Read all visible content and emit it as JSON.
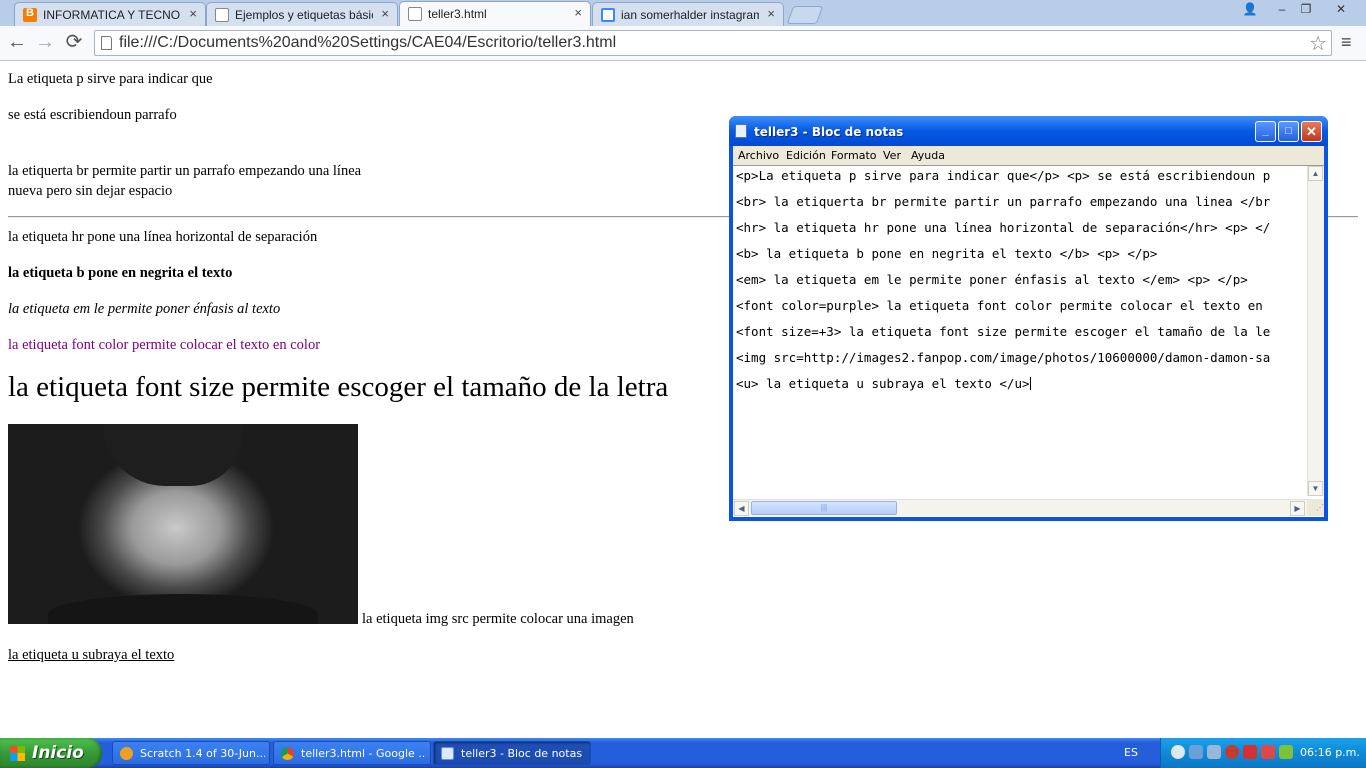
{
  "browser": {
    "tabs": [
      {
        "label": "INFORMATICA Y TECNOLOGIA",
        "close": "×",
        "favicon": "blogger-icon"
      },
      {
        "label": "Ejemplos y etiquetas básicas",
        "close": "×",
        "favicon": "page-icon"
      },
      {
        "label": "teller3.html",
        "close": "×",
        "favicon": "page-icon",
        "active": true
      },
      {
        "label": "ian somerhalder instagram - Bu",
        "close": "×",
        "favicon": "google-icon"
      }
    ],
    "window_buttons": {
      "user": "👤",
      "minimize": "–",
      "restore": "❐",
      "close": "✕"
    },
    "nav": {
      "back": "←",
      "forward": "→",
      "reload": "⟳",
      "star": "☆",
      "menu": "≡"
    },
    "address": "file:///C:/Documents%20and%20Settings/CAE04/Escritorio/teller3.html"
  },
  "page": {
    "p1": "La etiqueta p sirve para indicar que",
    "p2": "se está escribiendoun parrafo",
    "br1": "la etiquerta br permite partir un parrafo empezando una línea",
    "br2": "nueva pero sin dejar espacio",
    "hr_text": "la etiqueta hr pone una línea horizontal de separación",
    "bold_text": "la etiqueta b pone en negrita el texto",
    "em_text": "la etiqueta em le permite poner énfasis al texto",
    "color_text": "la etiqueta font color permite colocar el texto en color",
    "color_value": "#800080",
    "size_text": "la etiqueta font size permite escoger el tamaño de la letra",
    "img_caption": "la etiqueta img src permite colocar una imagen",
    "u_text": "la etiqueta u subraya el texto"
  },
  "notepad": {
    "title": "teller3 - Bloc de notas",
    "menu": [
      "Archivo",
      "Edición",
      "Formato",
      "Ver",
      "Ayuda"
    ],
    "lines": [
      "<p>La etiqueta p sirve para indicar que</p> <p> se está escribiendoun p",
      "<br> la etiquerta br permite partir un parrafo empezando una linea </br",
      "<hr> la etiqueta hr pone una línea horizontal de separación</hr> <p> </",
      "<b> la etiqueta b pone en negrita el texto </b> <p> </p>",
      "<em> la etiqueta em le permite poner énfasis al texto </em> <p> </p>",
      "<font color=purple> la etiqueta font color permite colocar el texto en",
      "<font size=+3> la etiqueta font size permite escoger el tamaño de la le",
      "<img src=http://images2.fanpop.com/image/photos/10600000/damon-damon-sa",
      "<u> la etiqueta u subraya el texto </u>"
    ],
    "buttons": {
      "minimize": "_",
      "maximize": "□",
      "close": "✕"
    }
  },
  "taskbar": {
    "start_label": "Inicio",
    "tasks": [
      {
        "label": "Scratch 1.4 of 30-Jun..."
      },
      {
        "label": "teller3.html - Google ..."
      },
      {
        "label": "teller3 - Bloc de notas",
        "active": true
      }
    ],
    "language": "ES",
    "clock": "06:16 p.m."
  }
}
